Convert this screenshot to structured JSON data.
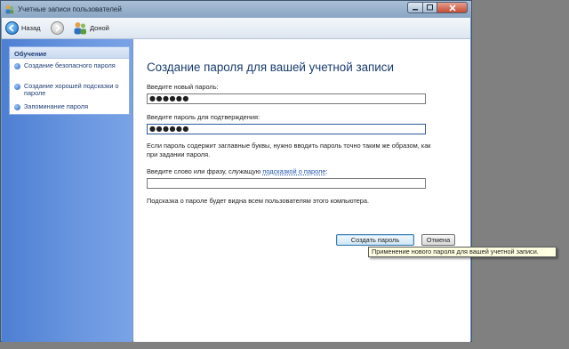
{
  "window": {
    "title": "Учетные записи пользователей"
  },
  "toolbar": {
    "back_label": "Назад",
    "home_label": "Доной"
  },
  "sidebar": {
    "panel_title": "Обучение",
    "items": [
      {
        "label": "Создание безопасного пароля"
      },
      {
        "label": "Создание хорошей подсказки о пароле"
      },
      {
        "label": "Запоминание пароля"
      }
    ]
  },
  "main": {
    "heading": "Создание пароля для вашей учетной записи",
    "new_password_label": "Введите новый пароль:",
    "new_password_value": "●●●●●●",
    "confirm_label": "Введите пароль для подтверждения:",
    "confirm_value": "●●●●●●",
    "case_note": "Если пароль содержит заглавные буквы, нужно вводить пароль точно таким же образом, как при задании пароля.",
    "hint_label_prefix": "Введите слово или фразу, служащую ",
    "hint_label_link": "подсказкой о пароле",
    "hint_label_suffix": ":",
    "hint_value": "",
    "hint_note": "Подсказка о пароле будет видна всем пользователям этого компьютера.",
    "create_button": "Создать пароль",
    "cancel_button": "Отмена"
  },
  "tooltip": {
    "text": "Применение нового пароля для вашей учетной записи."
  },
  "colors": {
    "heading": "#1a3c6e",
    "sidebar": "#5b8ad8",
    "link": "#2255aa"
  }
}
